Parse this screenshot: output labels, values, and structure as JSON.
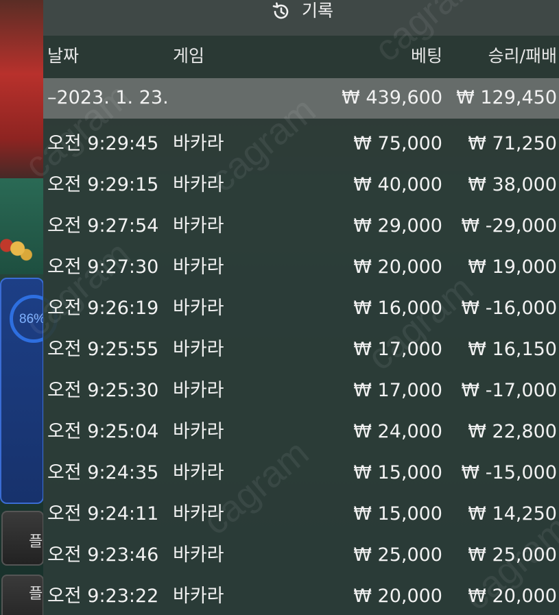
{
  "background": {
    "ring_percent_text": "86%",
    "button_1_text": "플",
    "button_2_text": "플"
  },
  "panel": {
    "title": "기록",
    "icon": "history-icon"
  },
  "columns": {
    "date": "날짜",
    "game": "게임",
    "bet": "베팅",
    "result": "승리/패배"
  },
  "summary": {
    "date": "–2023. 1. 23.",
    "bet": "₩ 439,600",
    "result": "₩ 129,450"
  },
  "rows": [
    {
      "time": "오전 9:29:45",
      "game": "바카라",
      "bet": "₩ 75,000",
      "result": "₩ 71,250"
    },
    {
      "time": "오전 9:29:15",
      "game": "바카라",
      "bet": "₩ 40,000",
      "result": "₩ 38,000"
    },
    {
      "time": "오전 9:27:54",
      "game": "바카라",
      "bet": "₩ 29,000",
      "result": "₩ -29,000"
    },
    {
      "time": "오전 9:27:30",
      "game": "바카라",
      "bet": "₩ 20,000",
      "result": "₩ 19,000"
    },
    {
      "time": "오전 9:26:19",
      "game": "바카라",
      "bet": "₩ 16,000",
      "result": "₩ -16,000"
    },
    {
      "time": "오전 9:25:55",
      "game": "바카라",
      "bet": "₩ 17,000",
      "result": "₩ 16,150"
    },
    {
      "time": "오전 9:25:30",
      "game": "바카라",
      "bet": "₩ 17,000",
      "result": "₩ -17,000"
    },
    {
      "time": "오전 9:25:04",
      "game": "바카라",
      "bet": "₩ 24,000",
      "result": "₩ 22,800"
    },
    {
      "time": "오전 9:24:35",
      "game": "바카라",
      "bet": "₩ 15,000",
      "result": "₩ -15,000"
    },
    {
      "time": "오전 9:24:11",
      "game": "바카라",
      "bet": "₩ 15,000",
      "result": "₩ 14,250"
    },
    {
      "time": "오전 9:23:46",
      "game": "바카라",
      "bet": "₩ 25,000",
      "result": "₩ 25,000"
    },
    {
      "time": "오전 9:23:22",
      "game": "바카라",
      "bet": "₩ 20,000",
      "result": "₩ 20,000"
    }
  ],
  "watermark": "cagram"
}
